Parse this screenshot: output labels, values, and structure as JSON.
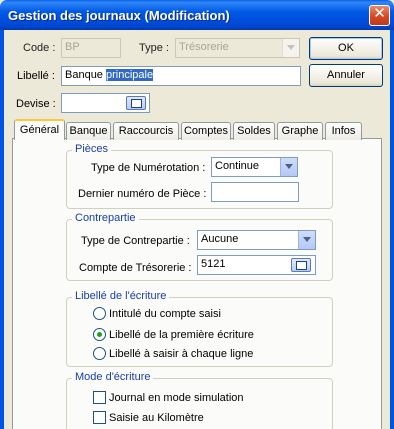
{
  "window": {
    "title": "Gestion des journaux (Modification)"
  },
  "header": {
    "code_label": "Code :",
    "code_value": "BP",
    "type_label": "Type :",
    "type_value": "Trésorerie",
    "libelle_label": "Libellé :",
    "libelle_value_plain": "Banque ",
    "libelle_value_selected": "principale",
    "devise_label": "Devise :",
    "devise_value": ""
  },
  "buttons": {
    "ok": "OK",
    "cancel": "Annuler"
  },
  "tabs": [
    {
      "label": "Général",
      "active": true
    },
    {
      "label": "Banque"
    },
    {
      "label": "Raccourcis"
    },
    {
      "label": "Comptes"
    },
    {
      "label": "Soldes"
    },
    {
      "label": "Graphe"
    },
    {
      "label": "Infos"
    }
  ],
  "pieces": {
    "title": "Pièces",
    "numerotation_label": "Type de Numérotation :",
    "numerotation_value": "Continue",
    "last_number_label": "Dernier numéro de Pièce :",
    "last_number_value": ""
  },
  "contrepartie": {
    "title": "Contrepartie",
    "type_label": "Type de Contrepartie :",
    "type_value": "Aucune",
    "account_label": "Compte de Trésorerie :",
    "account_value": "5121"
  },
  "libelle_ecriture": {
    "title": "Libellé de l'écriture",
    "options": [
      {
        "label": "Intitulé du compte saisi",
        "selected": false
      },
      {
        "label": "Libellé de la première écriture",
        "selected": true
      },
      {
        "label": "Libellé à saisir à chaque ligne",
        "selected": false
      }
    ]
  },
  "mode_ecriture": {
    "title": "Mode d'écriture",
    "options": [
      {
        "label": "Journal en mode simulation",
        "checked": false
      },
      {
        "label": "Saisie au Kilomètre",
        "checked": false
      }
    ]
  },
  "colors": {
    "titlebar": "#0054e3",
    "group_title": "#1a3ea8",
    "selection": "#316ac5"
  }
}
